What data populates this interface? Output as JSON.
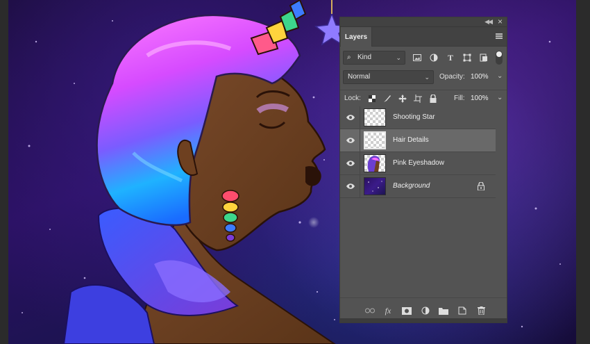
{
  "panel": {
    "tab_label": "Layers",
    "filter": {
      "label": "Kind"
    },
    "blend_mode": "Normal",
    "opacity": {
      "label": "Opacity:",
      "value": "100%"
    },
    "lock_label": "Lock:",
    "fill": {
      "label": "Fill:",
      "value": "100%"
    },
    "layers": [
      {
        "name": "Shooting Star",
        "visible": true,
        "selected": false,
        "locked": false,
        "thumb": "transparent"
      },
      {
        "name": "Hair Details",
        "visible": true,
        "selected": true,
        "locked": false,
        "thumb": "transparent"
      },
      {
        "name": "Pink Eyeshadow",
        "visible": true,
        "selected": false,
        "locked": false,
        "thumb": "art"
      },
      {
        "name": "Background",
        "visible": true,
        "selected": false,
        "locked": true,
        "thumb": "background"
      }
    ],
    "bottom_icons": [
      "link-layers-icon",
      "fx-icon",
      "add-mask-icon",
      "adjustment-layer-icon",
      "new-group-icon",
      "new-layer-icon",
      "delete-layer-icon"
    ],
    "fx_label": "fx"
  },
  "colors": {
    "panel_bg": "#535353",
    "selected_row": "#696969",
    "header_bg": "#424242"
  }
}
